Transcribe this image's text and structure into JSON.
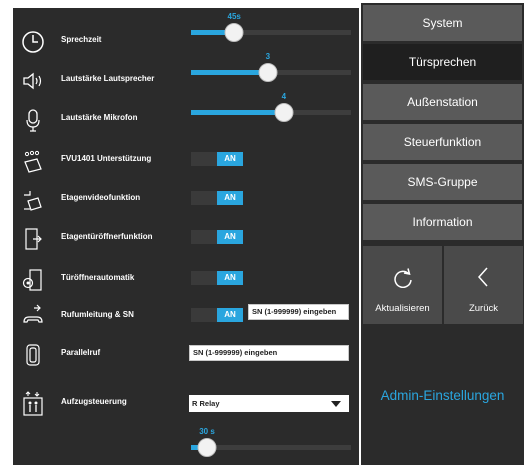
{
  "settings": {
    "sprechzeit": {
      "label": "Sprechzeit",
      "value_label": "45s",
      "level": 0.27
    },
    "lautsprecher": {
      "label": "Lautstärke Lautsprecher",
      "value_label": "3",
      "level": 0.48
    },
    "mikrofon": {
      "label": "Lautstärke Mikrofon",
      "value_label": "4",
      "level": 0.58
    },
    "fvu": {
      "label": "FVU1401 Unterstützung",
      "state": "AN"
    },
    "etagenvideo": {
      "label": "Etagenvideofunktion",
      "state": "AN"
    },
    "etagentuer": {
      "label": "Etagentüröffnerfunktion",
      "state": "AN"
    },
    "tueroeffner": {
      "label": "Türöffnerautomatik",
      "state": "AN"
    },
    "rufumleitung": {
      "label": "Rufumleitung & SN",
      "state": "AN",
      "input_placeholder": "SN (1-999999) eingeben"
    },
    "parallelruf": {
      "label": "Parallelruf",
      "input_placeholder": "SN (1-999999) eingeben"
    },
    "aufzug": {
      "label": "Aufzugsteuerung",
      "selected": "R Relay"
    },
    "aufzug_time": {
      "value_label": "30 s",
      "level": 0.1
    }
  },
  "icons": {
    "sprechzeit": "clock-icon",
    "lautsprecher": "speaker-icon",
    "mikrofon": "microphone-icon",
    "fvu": "camera-module-icon",
    "etagenvideo": "floor-video-icon",
    "etagentuer": "door-opener-icon",
    "tueroeffner": "auto-door-icon",
    "rufumleitung": "call-forward-icon",
    "parallelruf": "parallel-call-icon",
    "aufzug": "elevator-icon",
    "refresh": "refresh-icon",
    "back": "chevron-left-icon"
  },
  "menu": {
    "items": [
      "System",
      "Türsprechen",
      "Außenstation",
      "Steuerfunktion",
      "SMS-Gruppe",
      "Information"
    ],
    "active": "Türsprechen",
    "refresh_label": "Aktualisieren",
    "back_label": "Zurück",
    "section_title": "Admin-Einstellungen"
  },
  "colors": {
    "accent": "#2aa6df",
    "panel": "#2b2b2b",
    "menu_button": "#5a5a5a",
    "menu_active": "#1f1f1f"
  }
}
